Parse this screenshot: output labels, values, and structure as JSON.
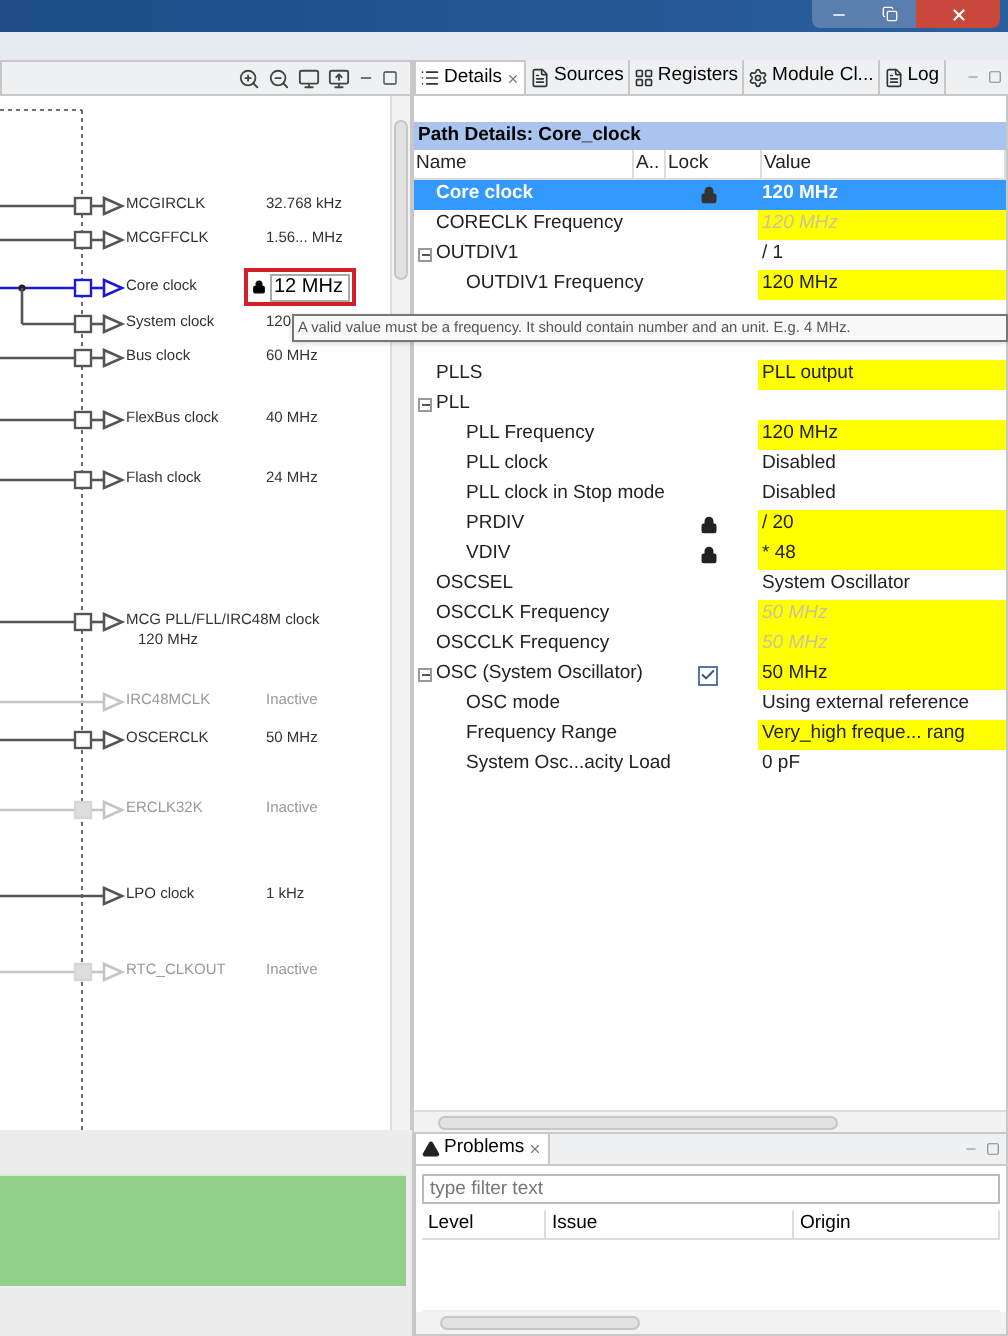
{
  "diagram": {
    "clocks": [
      {
        "name": "MCGIRCLK",
        "value": "32.768 kHz",
        "active": true,
        "gate": true,
        "selected": false
      },
      {
        "name": "MCGFFCLK",
        "value": "1.56... MHz",
        "active": true,
        "gate": true,
        "selected": false
      },
      {
        "name": "Core clock",
        "value": "12 MHz",
        "kind": "edit",
        "locked": true,
        "active": true,
        "gate": true,
        "selected": true
      },
      {
        "name": "System clock",
        "value": "120",
        "active": true,
        "gate": true,
        "selected": false
      },
      {
        "name": "Bus clock",
        "value": "60 MHz",
        "active": true,
        "gate": true,
        "selected": false
      },
      {
        "name": "FlexBus clock",
        "value": "40 MHz",
        "active": true,
        "gate": true,
        "selected": false
      },
      {
        "name": "Flash clock",
        "value": "24 MHz",
        "active": true,
        "gate": true,
        "selected": false
      },
      {
        "name": "MCG PLL/FLL/IRC48M clock",
        "value": "120 MHz",
        "kind": "stacked",
        "active": true,
        "gate": true,
        "selected": false
      },
      {
        "name": "IRC48MCLK",
        "value": "Inactive",
        "active": false,
        "gate": false,
        "selected": false
      },
      {
        "name": "OSCERCLK",
        "value": "50 MHz",
        "active": true,
        "gate": true,
        "selected": false
      },
      {
        "name": "ERCLK32K",
        "value": "Inactive",
        "active": false,
        "gate": true,
        "selected": false
      },
      {
        "name": "LPO clock",
        "value": "1 kHz",
        "active": true,
        "gate": false,
        "selected": false
      },
      {
        "name": "RTC_CLKOUT",
        "value": "Inactive",
        "active": false,
        "gate": true,
        "selected": false
      }
    ]
  },
  "tooltip": "A valid value must be a frequency. It should contain number and an unit. E.g. 4 MHz.",
  "details": {
    "tabs": [
      {
        "label": "Details",
        "closable": true,
        "selected": true
      },
      {
        "label": "Sources",
        "closable": false,
        "selected": false
      },
      {
        "label": "Registers",
        "closable": false,
        "selected": false
      },
      {
        "label": "Module Cl...",
        "closable": false,
        "selected": false
      },
      {
        "label": "Log",
        "closable": false,
        "selected": false
      }
    ],
    "path_title": "Path Details: Core_clock",
    "columns": [
      "Name",
      "A..",
      "Lock",
      "Value"
    ],
    "rows": [
      {
        "name": "Core clock",
        "value": "120 MHz",
        "locked": true,
        "highlight": false,
        "muted": false,
        "selected": true
      },
      {
        "name": "CORECLK Frequency",
        "value": "120 MHz",
        "locked": false,
        "highlight": true,
        "muted": true,
        "selected": false
      },
      {
        "name": "OUTDIV1",
        "value": "/ 1",
        "locked": false,
        "highlight": false,
        "muted": false,
        "selected": false,
        "expanded": true,
        "children": [
          {
            "name": "OUTDIV1 Frequency",
            "value": "120 MHz",
            "locked": false,
            "highlight": true,
            "muted": false,
            "selected": false
          }
        ]
      },
      {
        "name": "PLLS",
        "value": "PLL output",
        "locked": false,
        "highlight": true,
        "muted": false,
        "selected": false
      },
      {
        "name": "PLL",
        "locked": false,
        "highlight": false,
        "selected": false,
        "expanded": true,
        "children": [
          {
            "name": "PLL Frequency",
            "value": "120 MHz",
            "locked": false,
            "highlight": true,
            "muted": false,
            "selected": false
          },
          {
            "name": "PLL clock",
            "value": "Disabled",
            "locked": false,
            "highlight": false,
            "muted": false,
            "selected": false
          },
          {
            "name": "PLL clock in Stop mode",
            "value": "Disabled",
            "locked": false,
            "highlight": false,
            "muted": false,
            "selected": false
          },
          {
            "name": "PRDIV",
            "value": "/ 20",
            "locked": true,
            "highlight": true,
            "muted": false,
            "selected": false
          },
          {
            "name": "VDIV",
            "value": "* 48",
            "locked": true,
            "highlight": true,
            "muted": false,
            "selected": false
          }
        ]
      },
      {
        "name": "OSCSEL",
        "value": "System Oscillator",
        "locked": false,
        "highlight": false,
        "muted": false,
        "selected": false
      },
      {
        "name": "OSCCLK Frequency",
        "value": "50 MHz",
        "locked": false,
        "highlight": true,
        "muted": true,
        "selected": false
      },
      {
        "name": "OSCCLK Frequency",
        "value": "50 MHz",
        "locked": false,
        "highlight": true,
        "muted": true,
        "selected": false
      },
      {
        "name": "OSC (System Oscillator)",
        "value": "50 MHz",
        "locked": false,
        "highlight": true,
        "muted": false,
        "selected": false,
        "checked": true,
        "expanded": true,
        "children": [
          {
            "name": "OSC mode",
            "value": "Using external reference",
            "locked": false,
            "highlight": false,
            "muted": false,
            "selected": false
          },
          {
            "name": "Frequency Range",
            "value": "Very_high freque... rang",
            "locked": false,
            "highlight": true,
            "muted": false,
            "selected": false
          },
          {
            "name": "System Osc...acity Load",
            "value": "0 pF",
            "locked": false,
            "highlight": false,
            "muted": false,
            "selected": false
          }
        ]
      }
    ]
  },
  "problems": {
    "tab": "Problems",
    "filter_placeholder": "type filter text",
    "columns": [
      "Level",
      "Issue",
      "Origin"
    ]
  }
}
